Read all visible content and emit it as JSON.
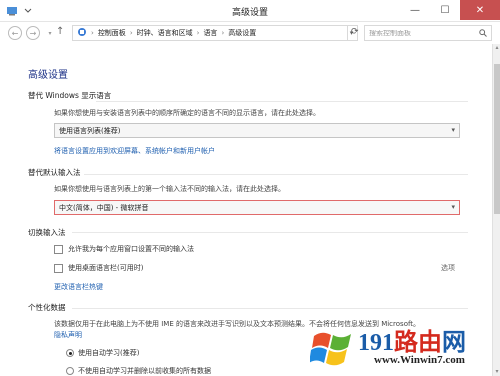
{
  "window": {
    "title": "高级设置",
    "minimize": "—",
    "maximize": "☐",
    "close": "✕"
  },
  "nav": {
    "back": "←",
    "forward": "→",
    "up": "↑",
    "breadcrumb": [
      "控制面板",
      "时钟、语言和区域",
      "语言",
      "高级设置"
    ],
    "separator": "›",
    "search_placeholder": "搜索控制面板"
  },
  "page": {
    "title": "高级设置",
    "display_language": {
      "heading": "替代 Windows 显示语言",
      "description": "如果你想使用与安装语言列表中的顺序所确定的语言不同的显示语言，请在此处选择。",
      "selected": "使用语言列表(推荐)",
      "link": "将语言设置应用到欢迎屏幕、系统帐户和新用户帐户"
    },
    "input_method": {
      "heading": "替代默认输入法",
      "description": "如果你想使用与语言列表上的第一个输入法不同的输入法，请在此处选择。",
      "selected": "中文(简体，中国) - 微软拼音"
    },
    "switch_input": {
      "heading": "切换输入法",
      "option1": "允许我为每个应用窗口设置不同的输入法",
      "option2": "使用桌面语言栏(可用时)",
      "options_link": "选项",
      "hotkey_link": "更改语言栏热键"
    },
    "personalization": {
      "heading": "个性化数据",
      "description": "该数据仅用于在此电脑上为不使用 IME 的语言来改进手写识别以及文本预测结果。不会将任何信息发送到 Microsoft。",
      "privacy_link": "隐私声明",
      "radio1": "使用自动学习(推荐)",
      "radio2": "不使用自动学习并删除以前收集的所有数据"
    }
  },
  "watermark": {
    "brand_num": "191",
    "brand_text": "路由",
    "brand_end": "网",
    "url": "www.Winwin7.com"
  }
}
